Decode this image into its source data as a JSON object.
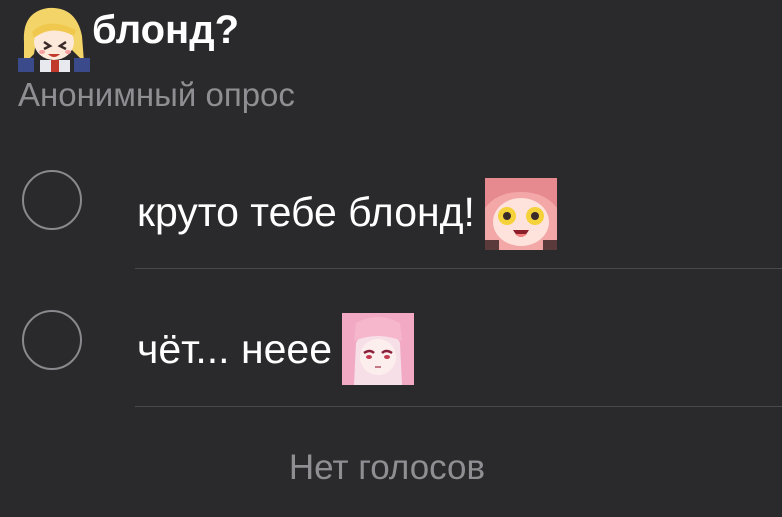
{
  "poll": {
    "title": "блонд?",
    "subtitle": "Анонимный опрос",
    "options": [
      {
        "label": "круто тебе блонд!",
        "sticker": "anime-surprised-pink-hair-icon"
      },
      {
        "label": "чёт... неее",
        "sticker": "anime-pink-hair-girl-icon"
      }
    ],
    "footer": "Нет голосов",
    "title_sticker": "anime-blonde-girl-icon"
  },
  "colors": {
    "background": "#2a2a2c",
    "text": "#ffffff",
    "secondary": "#8e8e93",
    "radio_border": "#8a8a8e",
    "divider": "#4a4a4d"
  }
}
